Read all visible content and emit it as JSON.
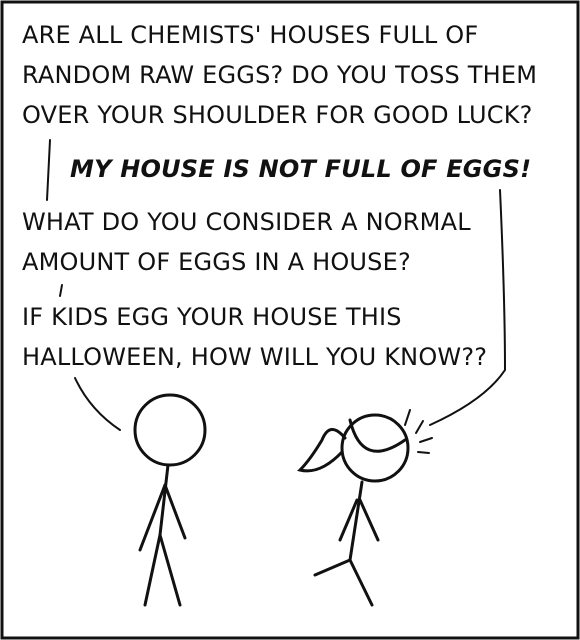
{
  "dialogue": {
    "line1": "ARE ALL CHEMISTS' HOUSES FULL OF",
    "line2": "RANDOM RAW EGGS? DO YOU TOSS THEM",
    "line3": "OVER YOUR SHOULDER FOR GOOD LUCK?",
    "reply": "MY HOUSE IS NOT FULL OF EGGS!",
    "line4": "WHAT DO YOU CONSIDER A NORMAL",
    "line5": "AMOUNT OF EGGS IN A HOUSE?",
    "line6": "IF KIDS EGG YOUR HOUSE THIS",
    "line7": "HALLOWEEN, HOW WILL YOU KNOW??"
  },
  "colors": {
    "ink": "#111111",
    "background": "#ffffff"
  }
}
